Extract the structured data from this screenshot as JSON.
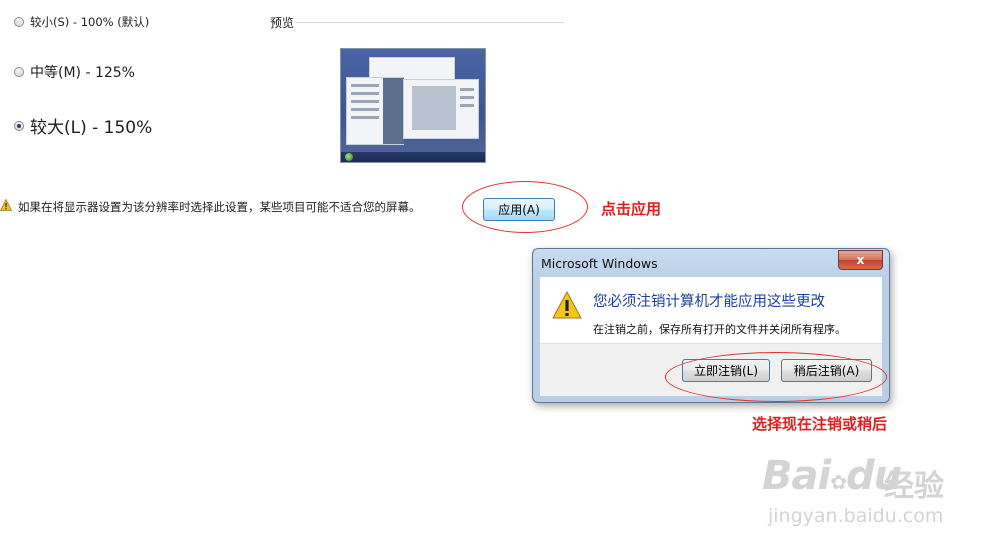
{
  "options": [
    {
      "label": "较小(S) - 100% (默认)",
      "selected": false
    },
    {
      "label": "中等(M) - 125%",
      "selected": false
    },
    {
      "label": "较大(L) - 150%",
      "selected": true
    }
  ],
  "preview": {
    "title": "预览"
  },
  "warning": {
    "text": "如果在将显示器设置为该分辨率时选择此设置，某些项目可能不适合您的屏幕。",
    "icon": "warning-icon"
  },
  "apply_button": {
    "label": "应用(A)"
  },
  "annotations": {
    "apply": "点击应用",
    "choose": "选择现在注销或稍后"
  },
  "dialog": {
    "title": "Microsoft Windows",
    "close": "x",
    "message": "您必须注销计算机才能应用这些更改",
    "detail": "在注销之前，保存所有打开的文件并关闭所有程序。",
    "logoff_now": "立即注销(L)",
    "logoff_later": "稍后注销(A)"
  },
  "watermark": {
    "logo": "Bai",
    "paw": "du",
    "cn": "经验",
    "url": "jingyan.baidu.com"
  },
  "colors": {
    "annotation": "#e02020",
    "dialog_text": "#1b3fa0"
  }
}
